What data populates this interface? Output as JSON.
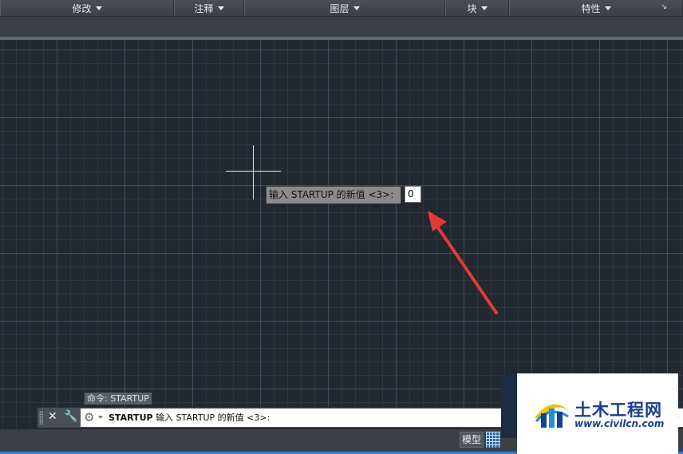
{
  "ribbon": {
    "panels": [
      {
        "label": "修改"
      },
      {
        "label": "注释"
      },
      {
        "label": "图层"
      },
      {
        "label": "块"
      },
      {
        "label": "特性"
      }
    ],
    "expand_icon": "expand-corner-icon"
  },
  "dynamic_input": {
    "prompt": "输入 STARTUP 的新值 <3>:",
    "value": "0"
  },
  "command_history": {
    "text": "命令: STARTUP"
  },
  "command_line": {
    "command": "STARTUP",
    "prompt": "输入 STARTUP 的新值 <3>:"
  },
  "status_bar": {
    "model_tab": "模型"
  },
  "watermark": {
    "title": "土木工程网",
    "url": "www.civilcn.com"
  },
  "colors": {
    "canvas_bg": "#212830",
    "annotation_arrow": "#e53935",
    "status_accent": "#2f7fd4",
    "watermark_text": "#1a3d8f"
  }
}
